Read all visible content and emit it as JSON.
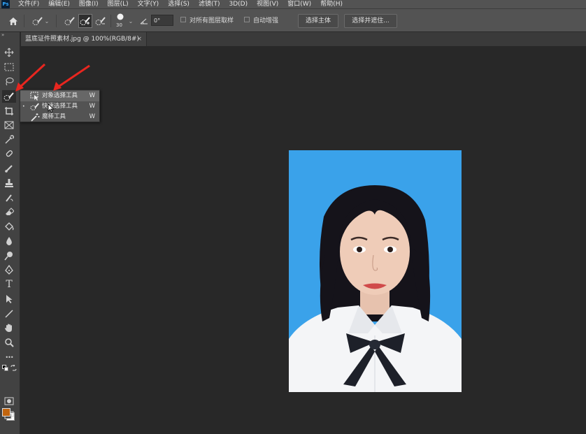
{
  "app": {
    "logo_text": "Ps"
  },
  "menu": [
    "文件(F)",
    "编辑(E)",
    "图像(I)",
    "图层(L)",
    "文字(Y)",
    "选择(S)",
    "滤镜(T)",
    "3D(D)",
    "视图(V)",
    "窗口(W)",
    "帮助(H)"
  ],
  "options": {
    "brush_size": "30",
    "angle_value": "0°",
    "sample_all_layers_label": "对所有图层取样",
    "auto_enhance_label": "自动增强",
    "select_subject_label": "选择主体",
    "select_and_mask_label": "选择并遮住..."
  },
  "document": {
    "tab_title": "蓝底证件照素材.jpg @ 100%(RGB/8#)",
    "close_glyph": "×"
  },
  "flyout": {
    "items": [
      {
        "label": "对象选择工具",
        "key": "W"
      },
      {
        "label": "快速选择工具",
        "key": "W"
      },
      {
        "label": "魔棒工具",
        "key": "W"
      }
    ],
    "bullet": "•"
  },
  "colors": {
    "foreground": "#c1650f",
    "background": "#ffffff",
    "photo_backdrop": "#3aa2ea",
    "annotation_arrow": "#e8261f"
  },
  "icons": {
    "type_tool_glyph": "T",
    "more_tools_glyph": "•••",
    "collapse_glyph": "»"
  }
}
